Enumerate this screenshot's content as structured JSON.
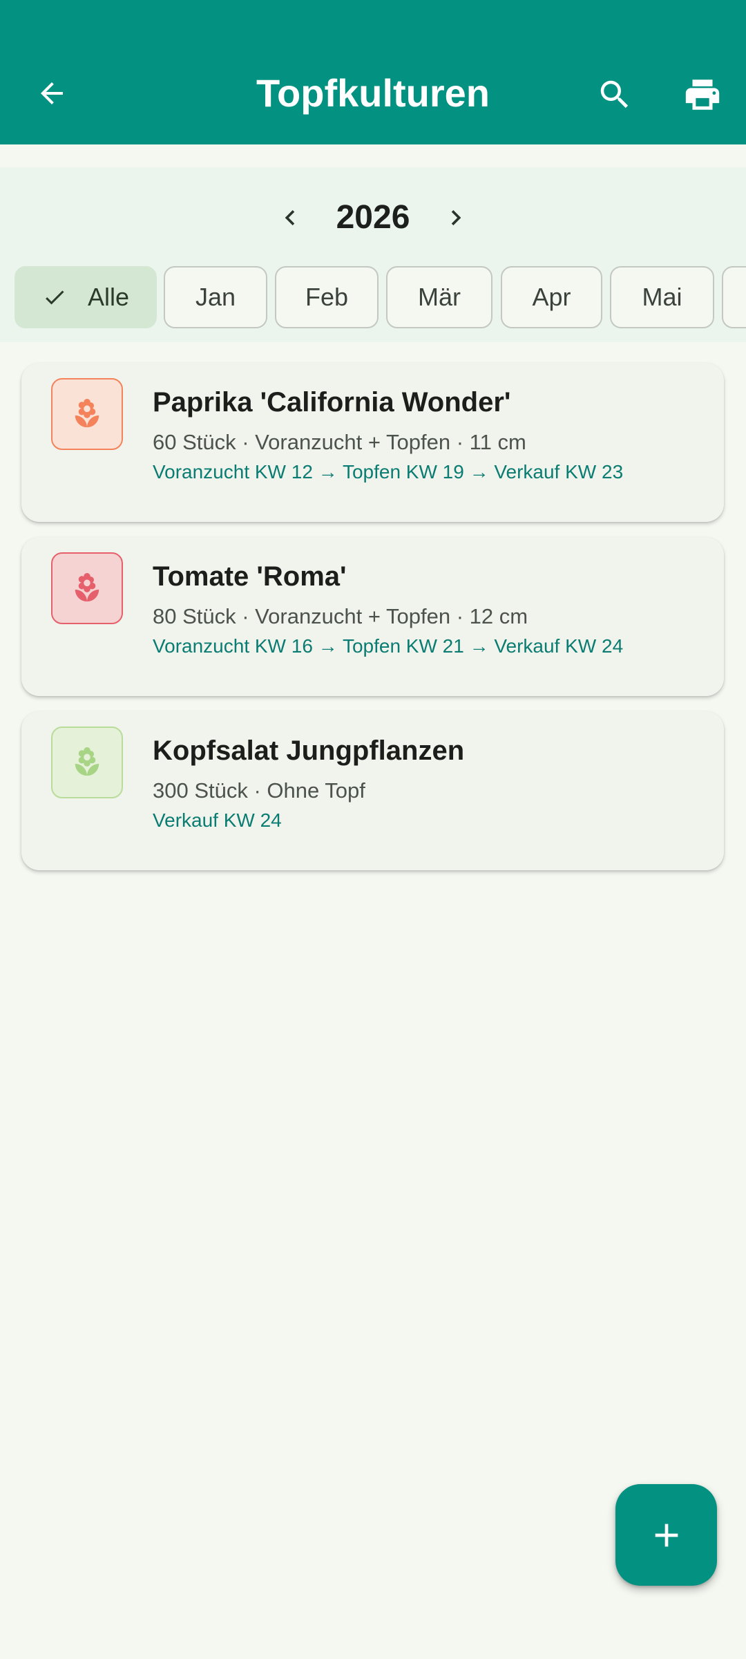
{
  "app_bar": {
    "title": "Topfkulturen",
    "back_icon": "arrow-left-icon",
    "search_icon": "search-icon",
    "print_icon": "printer-icon",
    "color": "#039282"
  },
  "year_selector": {
    "year": "2026",
    "prev_icon": "chevron-left-icon",
    "next_icon": "chevron-right-icon"
  },
  "month_filter": {
    "chips": [
      {
        "label": "Alle",
        "selected": true
      },
      {
        "label": "Jan",
        "selected": false
      },
      {
        "label": "Feb",
        "selected": false
      },
      {
        "label": "Mär",
        "selected": false
      },
      {
        "label": "Apr",
        "selected": false
      },
      {
        "label": "Mai",
        "selected": false
      }
    ]
  },
  "cultures": [
    {
      "name": "Paprika 'California Wonder'",
      "meta": "60 Stück · Voranzucht + Topfen · 11 cm",
      "schedule": "Voranzucht KW 12 → Topfen KW 19 → Verkauf KW 23",
      "icon": "flower-icon",
      "color": "#f4825a"
    },
    {
      "name": "Tomate 'Roma'",
      "meta": "80 Stück · Voranzucht + Topfen · 12 cm",
      "schedule": "Voranzucht KW 16 → Topfen KW 21 → Verkauf KW 24",
      "icon": "flower-icon",
      "color": "#e5606a"
    },
    {
      "name": "Kopfsalat Jungpflanzen",
      "meta": "300 Stück · Ohne Topf",
      "schedule": "Verkauf KW 24",
      "icon": "flower-icon",
      "color": "#a8d486"
    }
  ],
  "fab": {
    "icon": "plus-icon"
  }
}
